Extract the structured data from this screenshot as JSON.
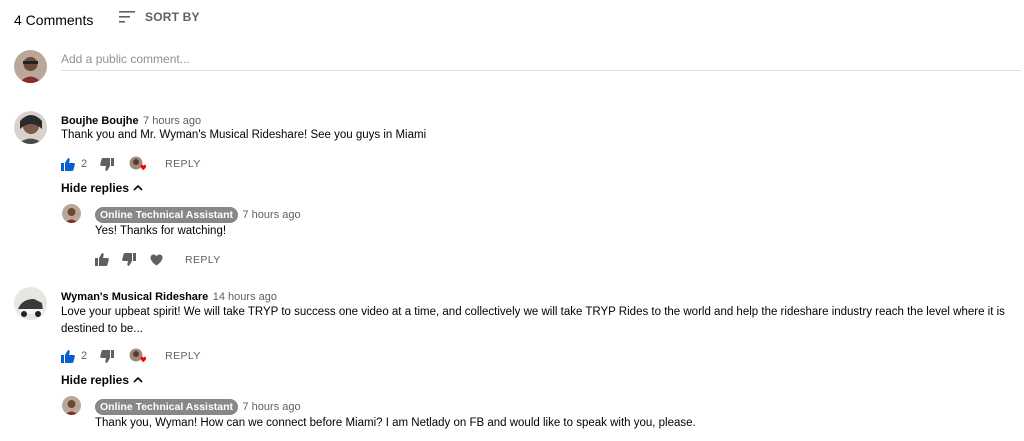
{
  "header": {
    "comment_count": "4 Comments",
    "sort_label": "SORT BY"
  },
  "composer": {
    "placeholder": "Add a public comment..."
  },
  "colors": {
    "like_active": "#065fd4",
    "icon_gray": "#606060",
    "heart": "#ff0000",
    "badge_bg": "#888888"
  },
  "comments": [
    {
      "author": "Boujhe Boujhe",
      "time": "7 hours ago",
      "text": "Thank you and Mr. Wyman's Musical Rideshare! See you guys in  Miami",
      "likes": "2",
      "reply_label": "REPLY",
      "hide_replies": "Hide replies",
      "reply": {
        "author": "Online Technical Assistant",
        "time": "7 hours ago",
        "text": "Yes! Thanks for watching!",
        "reply_label": "REPLY"
      }
    },
    {
      "author": "Wyman's Musical Rideshare",
      "time": "14 hours ago",
      "text": "Love your upbeat spirit! We will take TRYP to success one video at a time, and collectively we will take TRYP Rides to the world and help the rideshare industry reach the level where it is destined to be...",
      "likes": "2",
      "reply_label": "REPLY",
      "hide_replies": "Hide replies",
      "reply": {
        "author": "Online Technical Assistant",
        "time": "7 hours ago",
        "text": "Thank you, Wyman!  How can we connect before Miami? I am Netlady on FB and would like to speak with you, please."
      }
    }
  ]
}
